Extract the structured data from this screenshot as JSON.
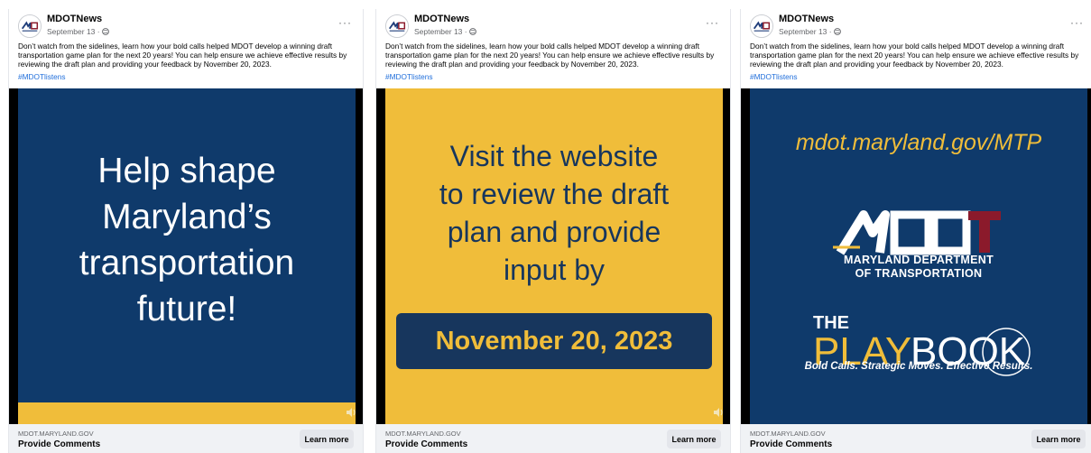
{
  "colors": {
    "navy": "#0f3a6b",
    "gold": "#f0bd3a",
    "link": "#216fdb",
    "maroon": "#8b1a2b"
  },
  "icons": [
    "mdot-logo-icon",
    "globe-icon",
    "more-icon",
    "speaker-icon"
  ],
  "posts": [
    {
      "page_name": "MDOTNews",
      "date": "September 13 ·",
      "more": "···",
      "text": "Don’t watch from the sidelines, learn how your bold calls helped MDOT develop a winning draft transportation game plan for the next 20 years! You can help ensure we achieve effective results by reviewing the draft plan and providing your feedback by November 20, 2023.",
      "hashtag": "#MDOTlistens",
      "creative": {
        "headline": [
          "Help shape",
          "Maryland’s",
          "transportation",
          "future!"
        ]
      },
      "domain": "MDOT.MARYLAND.GOV",
      "cta_title": "Provide Comments",
      "button": "Learn more"
    },
    {
      "page_name": "MDOTNews",
      "date": "September 13 ·",
      "more": "···",
      "text": "Don’t watch from the sidelines, learn how your bold calls helped MDOT develop a winning draft transportation game plan for the next 20 years! You can help ensure we achieve effective results by reviewing the draft plan and providing your feedback by November 20, 2023.",
      "hashtag": "#MDOTlistens",
      "creative": {
        "headline": [
          "Visit the website",
          "to review the draft",
          "plan and provide",
          "input by"
        ],
        "date": "November 20, 2023"
      },
      "domain": "MDOT.MARYLAND.GOV",
      "cta_title": "Provide Comments",
      "button": "Learn more"
    },
    {
      "page_name": "MDOTNews",
      "date": "September 13 ·",
      "more": "···",
      "text": "Don’t watch from the sidelines, learn how your bold calls helped MDOT develop a winning draft transportation game plan for the next 20 years! You can help ensure we achieve effective results by reviewing the draft plan and providing your feedback by November 20, 2023.",
      "hashtag": "#MDOTlistens",
      "creative": {
        "url": "mdot.maryland.gov/MTP",
        "dept_line1": "MARYLAND DEPARTMENT",
        "dept_line2": "OF TRANSPORTATION",
        "playbook_the": "THE",
        "playbook_play": "PLAY",
        "playbook_book": "BOOK",
        "tagline": "Bold Calls. Strategic Moves. Effective Results."
      },
      "domain": "MDOT.MARYLAND.GOV",
      "cta_title": "Provide Comments",
      "button": "Learn more"
    }
  ]
}
